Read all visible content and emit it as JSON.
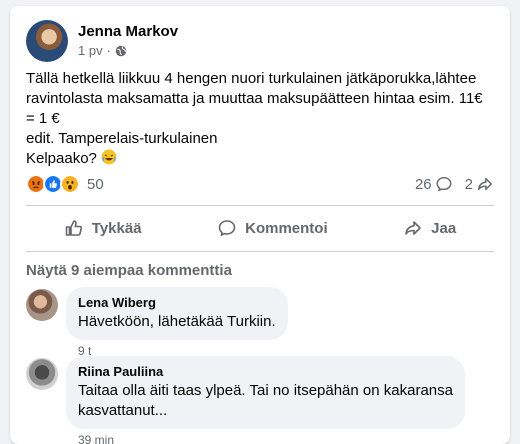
{
  "post": {
    "author": "Jenna Markov",
    "timestamp": "1 pv",
    "dot": "·",
    "privacy_icon": "globe-icon",
    "text_lines": [
      "Tällä hetkellä liikkuu 4 hengen nuori turkulainen jätkäporukka,lähtee",
      "ravintolasta maksamatta ja muuttaa maksupäätteen hintaa esim. 11€",
      "= 1 €",
      "edit. Tamperelais-turkulainen",
      "Kelpaako?"
    ]
  },
  "reactions": {
    "icons": [
      "angry-icon",
      "like-icon",
      "wow-icon"
    ],
    "count": "50",
    "comments_count": "26",
    "shares_count": "2"
  },
  "actions": {
    "like": "Tykkää",
    "comment": "Kommentoi",
    "share": "Jaa"
  },
  "comments_section": {
    "show_previous": "Näytä 9 aiempaa kommenttia",
    "comments": [
      {
        "name": "Lena Wiberg",
        "text": "Hävetköön, lähetäkää Turkiin.",
        "time": "9 t"
      },
      {
        "name": "Riina Pauliina",
        "text_lines": [
          "Taitaa olla äiti taas ylpeä. Tai no itsepähän on kakaransa",
          "kasvattanut..."
        ],
        "time": "39 min"
      }
    ]
  },
  "colors": {
    "like_blue": "#1877f2",
    "angry": "#e9710f",
    "wow": "#f7b125",
    "secondary_text": "#65676b"
  }
}
